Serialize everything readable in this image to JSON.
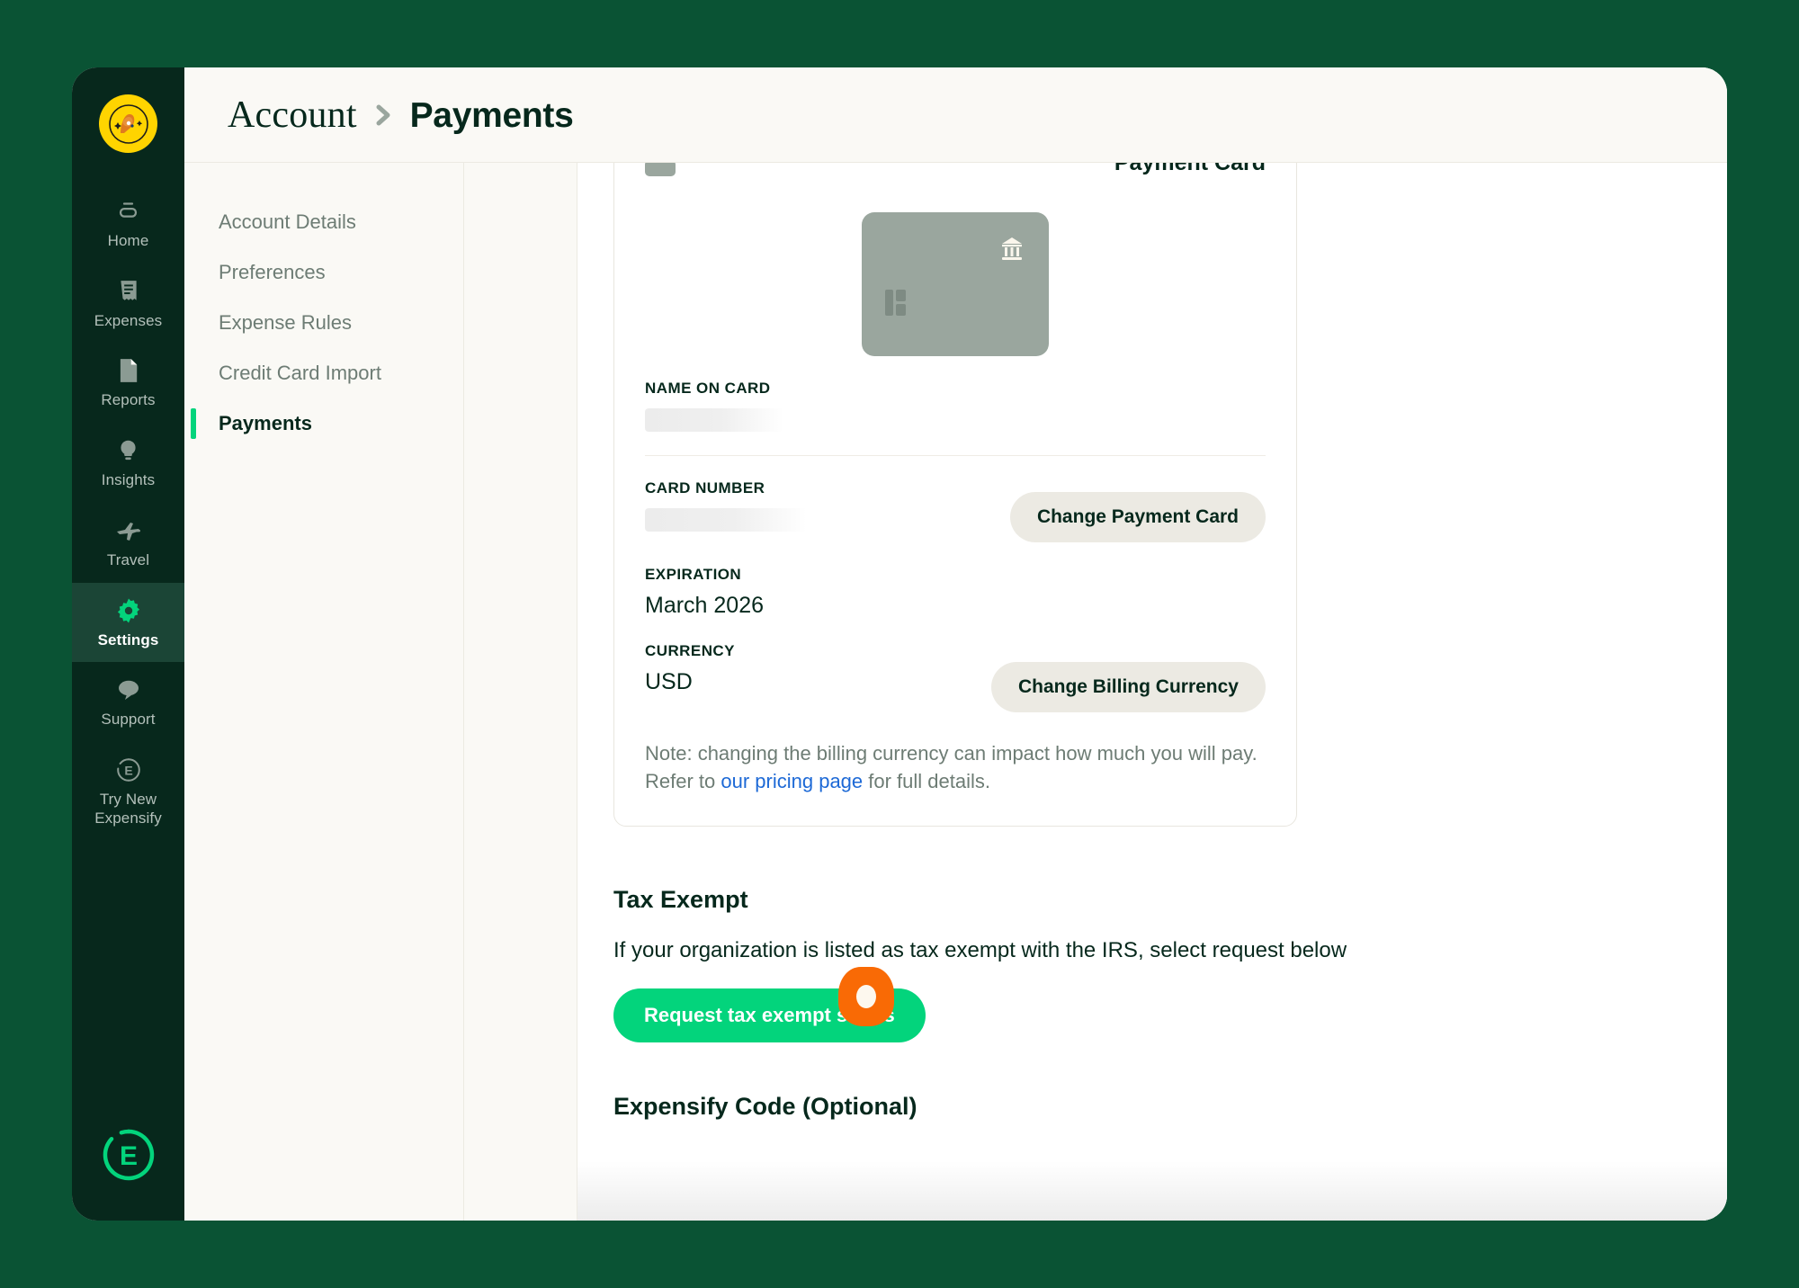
{
  "theme": {
    "page_bg": "#0a5334",
    "rail_bg": "#07281c",
    "rail_active_bg": "#1b4536",
    "accent_green": "#03d47c",
    "dark_green_text": "#06281c",
    "muted_text": "#6d7c74",
    "panel_bg": "#faf9f5",
    "link_blue": "#1d69d6",
    "cursor_orange": "#f96a05",
    "card_art_gray": "#9aa69e"
  },
  "rail": {
    "avatar_icon": "user-avatar-icon",
    "items": [
      {
        "label": "Home",
        "icon": "home-icon",
        "active": false
      },
      {
        "label": "Expenses",
        "icon": "receipt-icon",
        "active": false
      },
      {
        "label": "Reports",
        "icon": "document-icon",
        "active": false
      },
      {
        "label": "Insights",
        "icon": "lightbulb-icon",
        "active": false
      },
      {
        "label": "Travel",
        "icon": "airplane-icon",
        "active": false
      },
      {
        "label": "Settings",
        "icon": "gear-icon",
        "active": true
      },
      {
        "label": "Support",
        "icon": "chat-bubble-icon",
        "active": false
      },
      {
        "label": "Try New Expensify",
        "icon": "expensify-e-icon",
        "active": false
      }
    ],
    "logo_icon": "expensify-logo-icon"
  },
  "header": {
    "breadcrumb_root": "Account",
    "breadcrumb_separator_icon": "chevron-right-icon",
    "breadcrumb_leaf": "Payments"
  },
  "subnav": {
    "items": [
      {
        "label": "Account Details",
        "active": false
      },
      {
        "label": "Preferences",
        "active": false
      },
      {
        "label": "Expense Rules",
        "active": false
      },
      {
        "label": "Credit Card Import",
        "active": false
      },
      {
        "label": "Payments",
        "active": true
      }
    ]
  },
  "payment_card_panel": {
    "title": "Payment Card",
    "card_art": {
      "bank_icon": "bank-institution-icon",
      "chip_icon": "card-chip-icon"
    },
    "name_on_card": {
      "label": "NAME ON CARD",
      "value": "",
      "redacted": true
    },
    "card_number": {
      "label": "CARD NUMBER",
      "value": "",
      "redacted": true
    },
    "change_payment_card_button": "Change Payment Card",
    "expiration": {
      "label": "EXPIRATION",
      "value": "March 2026"
    },
    "currency": {
      "label": "CURRENCY",
      "value": "USD"
    },
    "change_billing_currency_button": "Change Billing Currency",
    "note": {
      "before_link": "Note: changing the billing currency can impact how much you will pay. Refer to ",
      "link_text": "our pricing page",
      "after_link": " for full details."
    }
  },
  "tax_exempt": {
    "title": "Tax Exempt",
    "description": "If your organization is listed as tax exempt with the IRS, select request below",
    "button_label": "Request tax exempt status",
    "cursor_marker": "click-cursor-marker"
  },
  "expensify_code": {
    "title": "Expensify Code (Optional)"
  }
}
